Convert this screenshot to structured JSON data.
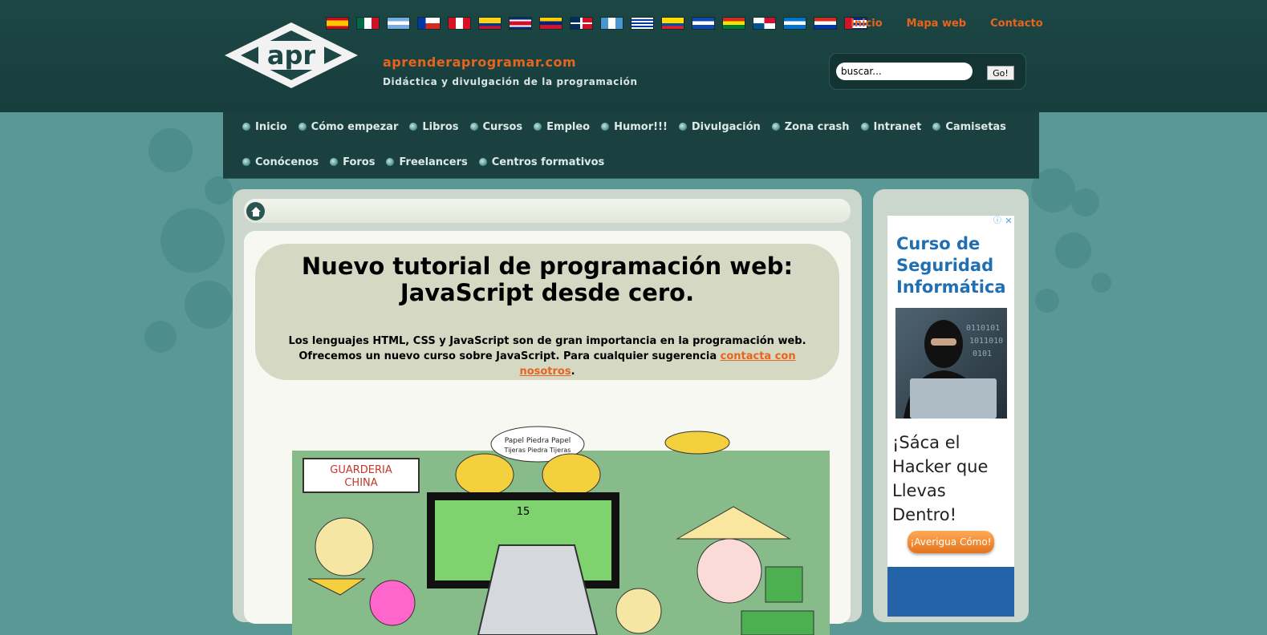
{
  "flags": [
    {
      "name": "spain-flag"
    },
    {
      "name": "mexico-flag"
    },
    {
      "name": "argentina-flag"
    },
    {
      "name": "chile-flag"
    },
    {
      "name": "peru-flag"
    },
    {
      "name": "colombia-flag"
    },
    {
      "name": "costa-rica-flag"
    },
    {
      "name": "venezuela-flag"
    },
    {
      "name": "dominican-republic-flag"
    },
    {
      "name": "guatemala-flag"
    },
    {
      "name": "uruguay-flag"
    },
    {
      "name": "ecuador-flag"
    },
    {
      "name": "el-salvador-flag"
    },
    {
      "name": "bolivia-flag"
    },
    {
      "name": "panama-flag"
    },
    {
      "name": "honduras-flag"
    },
    {
      "name": "paraguay-flag"
    },
    {
      "name": "cuba-flag"
    }
  ],
  "toplinks": {
    "inicio": "Inicio",
    "mapa": "Mapa web",
    "contacto": "Contacto"
  },
  "header": {
    "logo_text": "apr",
    "site_name": "aprenderaprogramar.com",
    "tagline": "Didáctica y divulgación de la programación"
  },
  "search": {
    "placeholder": "buscar...",
    "value": "buscar...",
    "button": "Go!"
  },
  "nav": {
    "row1": [
      "Inicio",
      "Cómo empezar",
      "Libros",
      "Cursos",
      "Empleo",
      "Humor!!!",
      "Divulgación",
      "Zona crash",
      "Intranet",
      "Camisetas"
    ],
    "row2": [
      "Conócenos",
      "Foros",
      "Freelancers",
      "Centros formativos"
    ]
  },
  "announcement": {
    "title_line1": "Nuevo tutorial de programación web:",
    "title_line2": "JavaScript desde cero.",
    "body_text": "Los lenguajes HTML, CSS y JavaScript son de gran importancia en la programación web. Ofrecemos un nuevo curso sobre JavaScript. Para cualquier sugerencia ",
    "link_text": "contacta con nosotros",
    "body_end": "."
  },
  "comic": {
    "sign": "GUARDERIA CHINA",
    "balloon": "Papel Piedra Papel Tijeras Piedra Tijeras",
    "score": "15"
  },
  "ad": {
    "title": "Curso de Seguridad Informática",
    "slogan": "¡Sáca el Hacker que Llevas Dentro!",
    "cta": "¡Averigua Cómo!",
    "info_icon": "info-icon",
    "close_icon": "close-icon"
  },
  "colors": {
    "accent": "#e8641c",
    "header_bg": "#1c4745",
    "page_bg": "#5a9896"
  }
}
